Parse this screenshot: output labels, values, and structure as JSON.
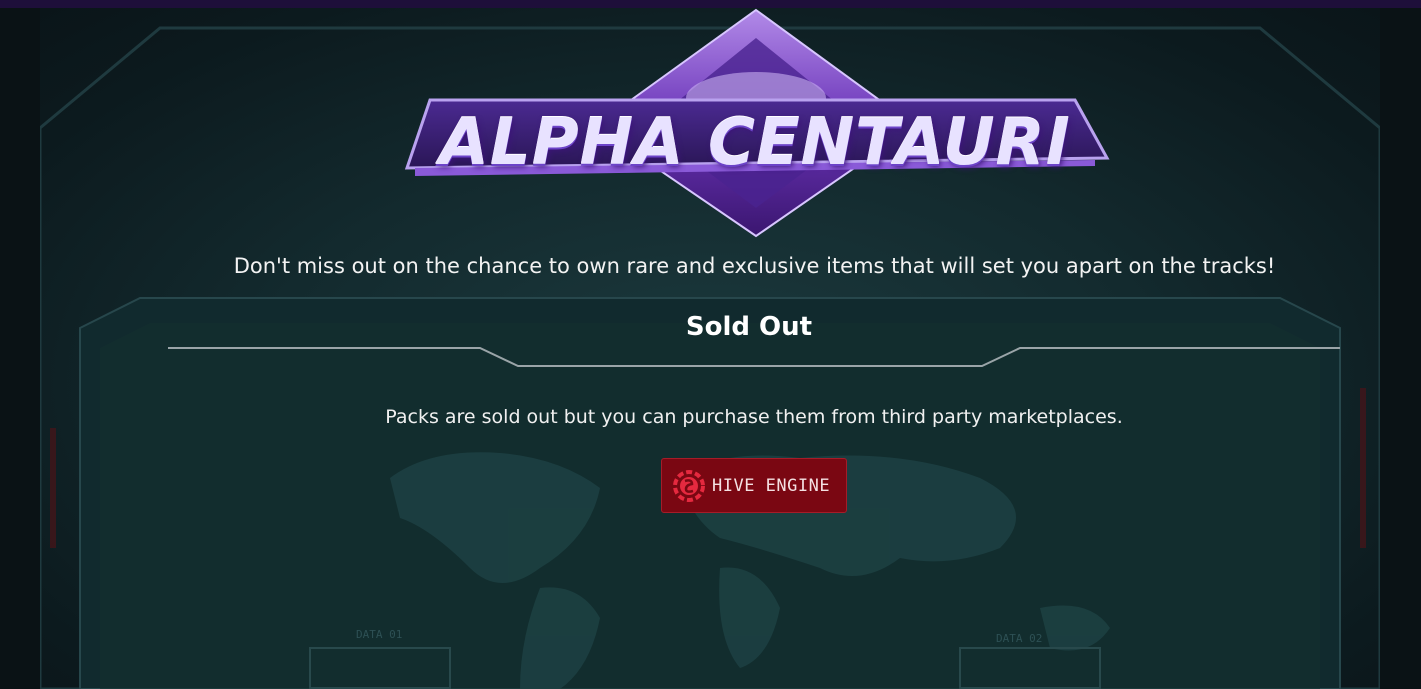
{
  "logo": {
    "text": "ALPHA CENTAURI"
  },
  "tagline": "Don't miss out on the chance to own rare and exclusive items that will set you apart on the tracks!",
  "section": {
    "title": "Sold Out"
  },
  "info": "Packs are sold out but you can purchase them from third party marketplaces.",
  "marketplace_button": {
    "label": "HIVE ENGINE",
    "icon": "hive-engine-logo-icon",
    "color": "#7a0712"
  },
  "background": {
    "labels": [
      "DATA 01",
      "DATA 02"
    ]
  },
  "colors": {
    "accent_purple": "#7b3fc8",
    "background": "#0f2024"
  }
}
